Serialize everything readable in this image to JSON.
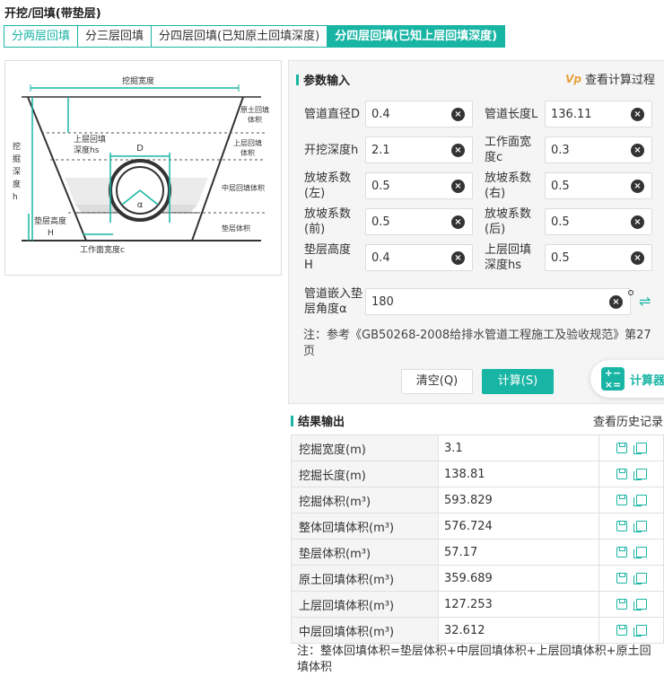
{
  "page": {
    "title": "开挖/回填(带垫层)"
  },
  "tabs": [
    {
      "label": "分两层回填"
    },
    {
      "label": "分三层回填"
    },
    {
      "label": "分四层回填(已知原土回填深度)"
    },
    {
      "label": "分四层回填(已知上层回填深度)"
    }
  ],
  "diagram": {
    "top_width": "挖掘宽度",
    "depth_h": [
      "挖",
      "掘",
      "深",
      "度",
      "h"
    ],
    "hs": [
      "上层回填",
      "深度hs"
    ],
    "D": "D",
    "alpha": "α",
    "bedding_h": [
      "垫层高度",
      "H"
    ],
    "work_c": "工作面宽度c",
    "zone_orig": [
      "原土回填",
      "体积"
    ],
    "zone_upper": [
      "上层回填",
      "体积"
    ],
    "zone_mid": "中层回填体积",
    "zone_bed": "垫层体积"
  },
  "params": {
    "title": "参数输入",
    "calc_process": "查看计算过程",
    "calc_process_badge": "Vp",
    "fields": [
      {
        "label": "管道直径D",
        "value": "0.4"
      },
      {
        "label": "管道长度L",
        "value": "136.11"
      },
      {
        "label": "开挖深度h",
        "value": "2.1"
      },
      {
        "label": "工作面宽度c",
        "value": "0.3"
      },
      {
        "label": "放坡系数(左)",
        "value": "0.5"
      },
      {
        "label": "放坡系数(右)",
        "value": "0.5"
      },
      {
        "label": "放坡系数(前)",
        "value": "0.5"
      },
      {
        "label": "放坡系数(后)",
        "value": "0.5"
      },
      {
        "label": "垫层高度H",
        "value": "0.4"
      },
      {
        "label": "上层回填深度hs",
        "value": "0.5"
      },
      {
        "label": "管道嵌入垫层角度α",
        "value": "180"
      }
    ],
    "note": "注：参考《GB50268-2008给排水管道工程施工及验收规范》第27页",
    "clear_btn": "清空(Q)",
    "calc_btn": "计算(S)",
    "float_btn": "计算器"
  },
  "results": {
    "title": "结果输出",
    "history": "查看历史记录",
    "rows": [
      {
        "label": "挖掘宽度(m)",
        "value": "3.1"
      },
      {
        "label": "挖掘长度(m)",
        "value": "138.81"
      },
      {
        "label": "挖掘体积(m³)",
        "value": "593.829"
      },
      {
        "label": "整体回填体积(m³)",
        "value": "576.724"
      },
      {
        "label": "垫层体积(m³)",
        "value": "57.17"
      },
      {
        "label": "原土回填体积(m³)",
        "value": "359.689"
      },
      {
        "label": "上层回填体积(m³)",
        "value": "127.253"
      },
      {
        "label": "中层回填体积(m³)",
        "value": "32.612"
      }
    ],
    "note": "注：整体回填体积=垫层体积+中层回填体积+上层回填体积+原土回填体积"
  },
  "colors": {
    "accent": "#19b5a4"
  }
}
